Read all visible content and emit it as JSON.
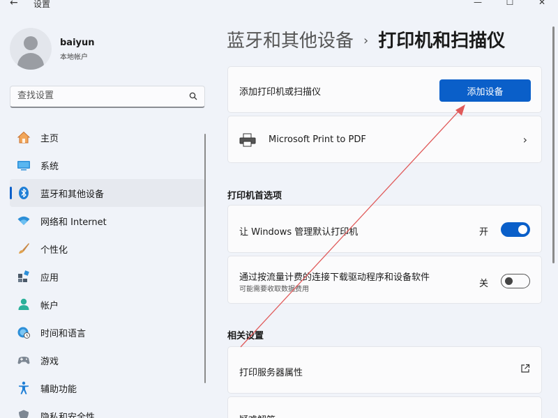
{
  "titlebar": {
    "back_glyph": "←",
    "title": "设置",
    "minimize_glyph": "—",
    "maximize_glyph": "☐",
    "close_glyph": "✕"
  },
  "profile": {
    "name": "baiyun",
    "account_type": "本地帐户"
  },
  "search": {
    "placeholder": "查找设置"
  },
  "sidebar": {
    "items": [
      {
        "label": "主页",
        "icon": "home-icon",
        "active": false
      },
      {
        "label": "系统",
        "icon": "system-icon",
        "active": false
      },
      {
        "label": "蓝牙和其他设备",
        "icon": "bluetooth-icon",
        "active": true
      },
      {
        "label": "网络和 Internet",
        "icon": "wifi-icon",
        "active": false
      },
      {
        "label": "个性化",
        "icon": "brush-icon",
        "active": false
      },
      {
        "label": "应用",
        "icon": "apps-icon",
        "active": false
      },
      {
        "label": "帐户",
        "icon": "account-icon",
        "active": false
      },
      {
        "label": "时间和语言",
        "icon": "globe-clock-icon",
        "active": false
      },
      {
        "label": "游戏",
        "icon": "gamepad-icon",
        "active": false
      },
      {
        "label": "辅助功能",
        "icon": "accessibility-icon",
        "active": false
      },
      {
        "label": "隐私和安全性",
        "icon": "shield-icon",
        "active": false
      }
    ]
  },
  "breadcrumb": {
    "parent": "蓝牙和其他设备",
    "separator": "›",
    "current": "打印机和扫描仪"
  },
  "add_device": {
    "label": "添加打印机或扫描仪",
    "button": "添加设备"
  },
  "printers": [
    {
      "name": "Microsoft Print to PDF"
    }
  ],
  "preferences": {
    "title": "打印机首选项",
    "items": [
      {
        "label": "让 Windows 管理默认打印机",
        "state_text": "开",
        "on": true
      },
      {
        "label": "通过按流量计费的连接下载驱动程序和设备软件",
        "sublabel": "可能需要收取数据费用",
        "state_text": "关",
        "on": false
      }
    ]
  },
  "related": {
    "title": "相关设置",
    "items": [
      {
        "label": "打印服务器属性"
      },
      {
        "label": "疑难解答"
      }
    ]
  },
  "colors": {
    "accent": "#0a5fc9",
    "annotation_arrow": "#e05a5a"
  }
}
